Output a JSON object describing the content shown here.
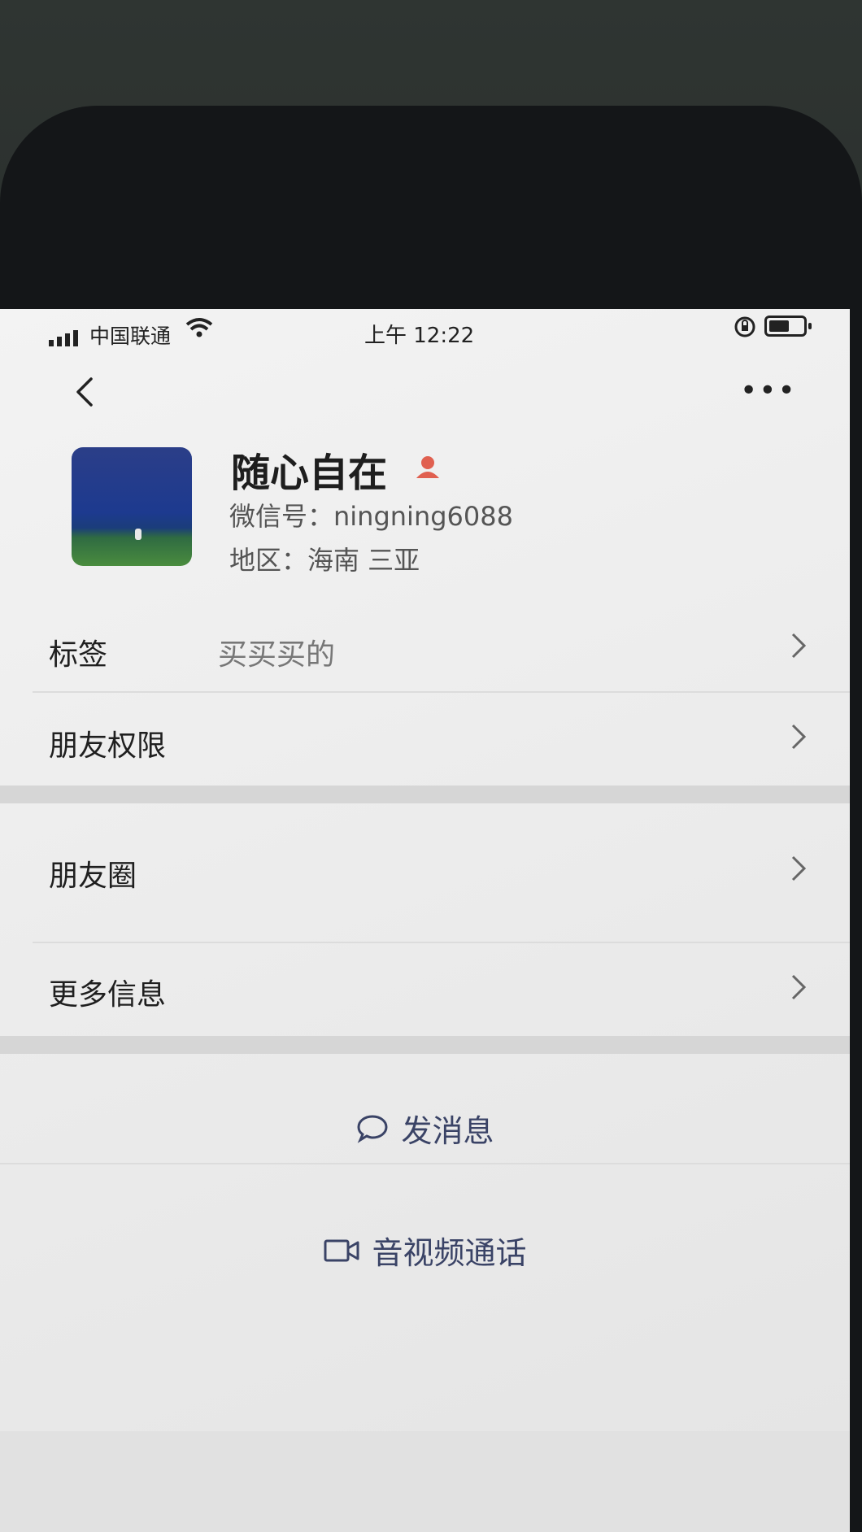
{
  "status_bar": {
    "carrier": "中国联通",
    "time": "上午 12:22"
  },
  "profile": {
    "name": "随心自在",
    "wechat_id": "微信号：ningning6088",
    "region": "地区：海南 三亚"
  },
  "rows": {
    "tags": {
      "label": "标签",
      "value": "买买买的"
    },
    "friend_permissions": {
      "label": "朋友权限"
    },
    "moments": {
      "label": "朋友圈"
    },
    "more_info": {
      "label": "更多信息"
    }
  },
  "actions": {
    "send_message": "发消息",
    "video_call": "音视频通话"
  },
  "icons": {
    "back": "chevron-left-icon",
    "more": "more-dots-icon",
    "badge": "person-badge-icon",
    "message": "chat-bubble-icon",
    "video": "video-camera-icon"
  },
  "colors": {
    "action_text": "#3a4366",
    "badge": "#e06050"
  }
}
